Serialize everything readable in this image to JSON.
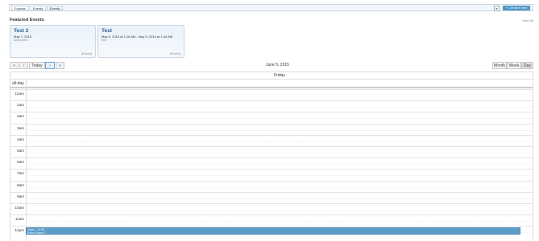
{
  "tabs": [
    "Forums",
    "Events",
    "Events"
  ],
  "create_label": "+ Create Event",
  "filter_icon": "filter-icon",
  "featured": {
    "title": "Featured Events",
    "view_all": "View All",
    "cards": [
      {
        "title": "Test 2",
        "date": "May 7, 2015",
        "sub": "Add a field",
        "tag": "[Events]"
      },
      {
        "title": "Test",
        "date": "May 5, 2015 at 1:26 AM - May 5, 2015 at 1:44 AM",
        "sub": "test",
        "tag": "[Events]"
      }
    ]
  },
  "nav": {
    "first": "«",
    "prev": "‹",
    "today": "Today",
    "next": "›",
    "last": "»"
  },
  "calendar_title": "June 5, 2015",
  "views": [
    "Month",
    "Week",
    "Day"
  ],
  "day_header": "Friday",
  "allday_label": "all-day",
  "hours": [
    "12am",
    "1am",
    "2am",
    "3am",
    "4am",
    "5am",
    "6am",
    "7am",
    "8am",
    "9am",
    "10am",
    "11am",
    "12pm"
  ],
  "event": {
    "time": "12pm - 12:30",
    "title": "Event Name 2"
  },
  "colors": {
    "accent": "#4f95c8",
    "event": "#5b9cc9"
  }
}
